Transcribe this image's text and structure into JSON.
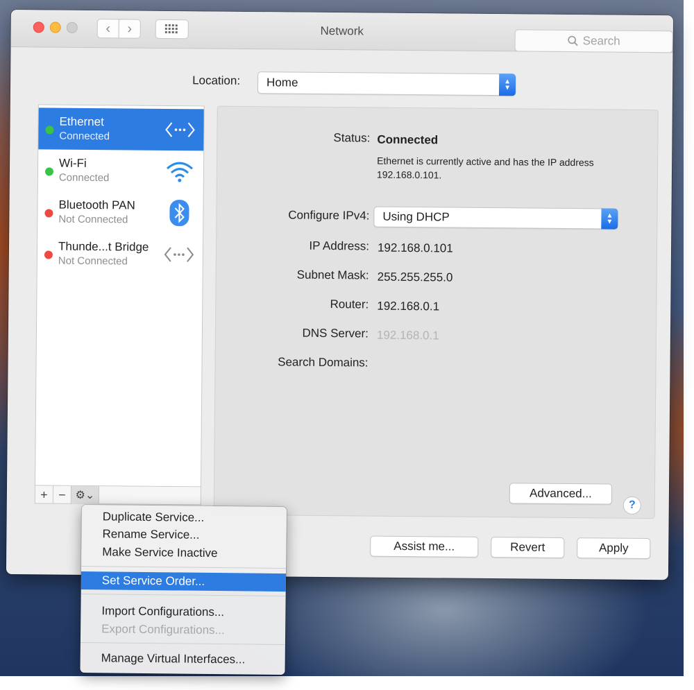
{
  "window": {
    "title": "Network",
    "search_placeholder": "Search"
  },
  "nav": {
    "back_glyph": "‹",
    "forward_glyph": "›",
    "grid_glyph": "⋮⋮⋮"
  },
  "location": {
    "label": "Location:",
    "value": "Home"
  },
  "services": [
    {
      "name": "Ethernet",
      "status": "Connected",
      "dot": "green",
      "icon": "ethernet-icon",
      "selected": true
    },
    {
      "name": "Wi-Fi",
      "status": "Connected",
      "dot": "green",
      "icon": "wifi-icon",
      "selected": false
    },
    {
      "name": "Bluetooth PAN",
      "status": "Not Connected",
      "dot": "red",
      "icon": "bluetooth-icon",
      "selected": false
    },
    {
      "name": "Thunde...t Bridge",
      "status": "Not Connected",
      "dot": "red",
      "icon": "thunderbolt-bridge-icon",
      "selected": false
    }
  ],
  "toolbar": {
    "add": "+",
    "remove": "−",
    "gear": "⚙⌄"
  },
  "detail": {
    "status_label": "Status:",
    "status_value": "Connected",
    "status_desc": "Ethernet is currently active and has the IP address 192.168.0.101.",
    "configure_label": "Configure IPv4:",
    "configure_value": "Using DHCP",
    "ip_label": "IP Address:",
    "ip_value": "192.168.0.101",
    "subnet_label": "Subnet Mask:",
    "subnet_value": "255.255.255.0",
    "router_label": "Router:",
    "router_value": "192.168.0.1",
    "dns_label": "DNS Server:",
    "dns_value": "192.168.0.1",
    "search_domains_label": "Search Domains:",
    "advanced_button": "Advanced...",
    "help_button": "?"
  },
  "buttons": {
    "assist": "Assist me...",
    "revert": "Revert",
    "apply": "Apply"
  },
  "menu": {
    "items": [
      {
        "label": "Duplicate Service..."
      },
      {
        "label": "Rename Service..."
      },
      {
        "label": "Make Service Inactive"
      },
      {
        "label": "Set Service Order..."
      },
      {
        "label": "Import Configurations..."
      },
      {
        "label": "Export Configurations..."
      },
      {
        "label": "Manage Virtual Interfaces..."
      }
    ],
    "highlighted": "Set Service Order...",
    "disabled": "Export Configurations..."
  },
  "colors": {
    "accent": "#2d7ce1",
    "status_green": "#3ac445",
    "status_red": "#ec4a42"
  }
}
